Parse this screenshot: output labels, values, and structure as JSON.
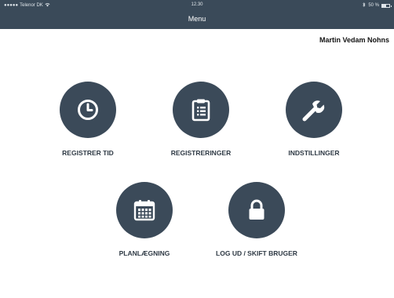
{
  "status_bar": {
    "carrier": "Telenor DK",
    "time": "12.30",
    "battery": "50 %"
  },
  "header": {
    "title": "Menu"
  },
  "user": {
    "name": "Martin Vedam Nohns"
  },
  "menu": {
    "items": [
      {
        "label": "REGISTRER TID",
        "icon": "clock-icon"
      },
      {
        "label": "REGISTRERINGER",
        "icon": "clipboard-icon"
      },
      {
        "label": "INDSTILLINGER",
        "icon": "wrench-icon"
      },
      {
        "label": "PLANLÆGNING",
        "icon": "calendar-icon"
      },
      {
        "label": "LOG UD / SKIFT BRUGER",
        "icon": "lock-icon"
      }
    ]
  },
  "colors": {
    "header_bg": "#3a4a59",
    "circle_bg": "#3b4a59",
    "icon": "#ffffff"
  }
}
